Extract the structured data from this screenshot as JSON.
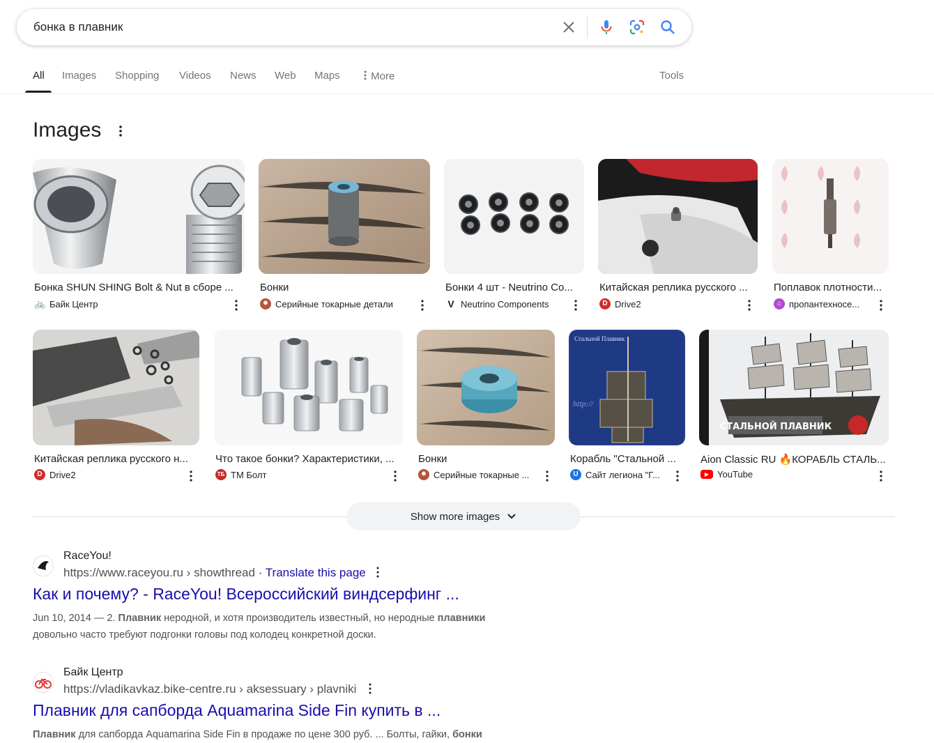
{
  "search": {
    "query": "бонка в плавник",
    "clear_label": "✕"
  },
  "tabs": [
    "All",
    "Images",
    "Shopping",
    "Videos",
    "News",
    "Web",
    "Maps",
    "More",
    "Tools"
  ],
  "images": {
    "heading": "Images",
    "row1": [
      {
        "title": "Бонка SHUN SHING Bolt & Nut в сборе ...",
        "source": "Байк Центр"
      },
      {
        "title": "Бонки",
        "source": "Серийные токарные детали"
      },
      {
        "title": "Бонки 4 шт - Neutrino Co...",
        "source": "Neutrino Components"
      },
      {
        "title": "Китайская реплика русского ...",
        "source": "Drive2"
      },
      {
        "title": "Поплавок плотности...",
        "source": "пропантехносе..."
      }
    ],
    "row2": [
      {
        "title": "Китайская реплика русского н...",
        "source": "Drive2"
      },
      {
        "title": "Что такое бонки? Характеристики, ...",
        "source": "ТМ Болт"
      },
      {
        "title": "Бонки",
        "source": "Серийные токарные ..."
      },
      {
        "title": "Корабль \"Стальной ...",
        "source": "Сайт легиона \"Г..."
      },
      {
        "title": "Aion Classic RU 🔥КОРАБЛЬ СТАЛЬ...",
        "source": "YouTube"
      }
    ],
    "thumb_text": {
      "ship_banner": "СТАЛЬНОЙ ПЛАВНИК",
      "map_title": "Стальной Плавник",
      "map_url": "http://"
    },
    "show_more": "Show more images"
  },
  "results": [
    {
      "site": "RaceYou!",
      "url": "https://www.raceyou.ru › showthread",
      "translate": "· Translate this page",
      "title": "Как и почему? - RaceYou! Всероссийский виндсерфинг ...",
      "date": "Jun 10, 2014 — 2.",
      "snip_b1": "Плавник",
      "snip_t1": " неродной, и хотя производитель известный, но неродные ",
      "snip_b2": "плавники",
      "snip_t2": "довольно часто требуют подгонки головы под колодец конкретной доски."
    },
    {
      "site": "Байк Центр",
      "url": "https://vladikavkaz.bike-centre.ru › aksessuary › plavniki",
      "title": "Плавник для сапборда Aquamarina Side Fin купить в ...",
      "snip_b1": "Плавник",
      "snip_t1": " для сапборда Aquamarina Side Fin в продаже по цене 300 руб. ... Болты, гайки, ",
      "snip_b2": "бонки"
    }
  ],
  "colors": {
    "link": "#1a0dab",
    "accent_blue": "#4285f4",
    "text": "#202124",
    "muted": "#70757a"
  }
}
